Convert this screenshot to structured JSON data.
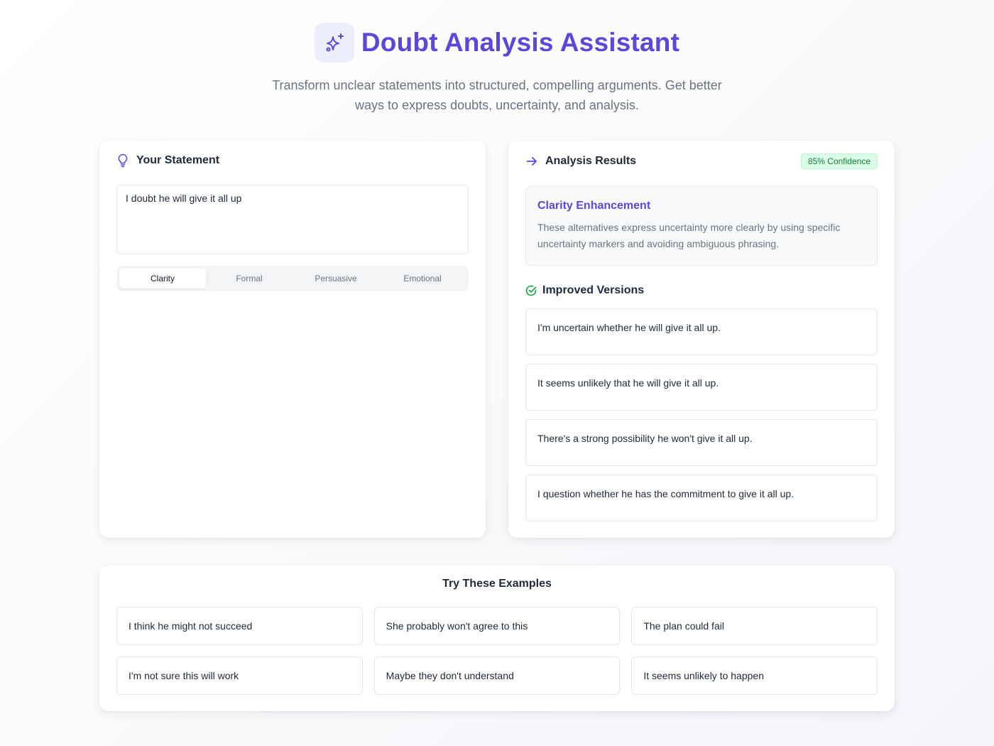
{
  "header": {
    "title": "Doubt Analysis Assistant",
    "subtitle": "Transform unclear statements into structured, compelling arguments. Get better ways to express doubts, uncertainty, and analysis.",
    "logo_icon": "sparkles-icon"
  },
  "colors": {
    "accent": "#5b47d8",
    "success": "#16a34a",
    "text": "#1f2937",
    "muted": "#6b7280"
  },
  "statement": {
    "title": "Your Statement",
    "icon": "lightbulb-icon",
    "value": "I doubt he will give it all up",
    "tabs": [
      {
        "label": "Clarity",
        "active": true
      },
      {
        "label": "Formal",
        "active": false
      },
      {
        "label": "Persuasive",
        "active": false
      },
      {
        "label": "Emotional",
        "active": false
      }
    ]
  },
  "results": {
    "title": "Analysis Results",
    "icon": "arrow-right-icon",
    "confidence": "85% Confidence",
    "enhancement": {
      "title": "Clarity Enhancement",
      "description": "These alternatives express uncertainty more clearly by using specific uncertainty markers and avoiding ambiguous phrasing."
    },
    "improved_title": "Improved Versions",
    "improved_icon": "check-circle-icon",
    "versions": [
      "I'm uncertain whether he will give it all up.",
      "It seems unlikely that he will give it all up.",
      "There's a strong possibility he won't give it all up.",
      "I question whether he has the commitment to give it all up."
    ]
  },
  "examples": {
    "title": "Try These Examples",
    "items": [
      "I think he might not succeed",
      "She probably won't agree to this",
      "The plan could fail",
      "I'm not sure this will work",
      "Maybe they don't understand",
      "It seems unlikely to happen"
    ]
  }
}
